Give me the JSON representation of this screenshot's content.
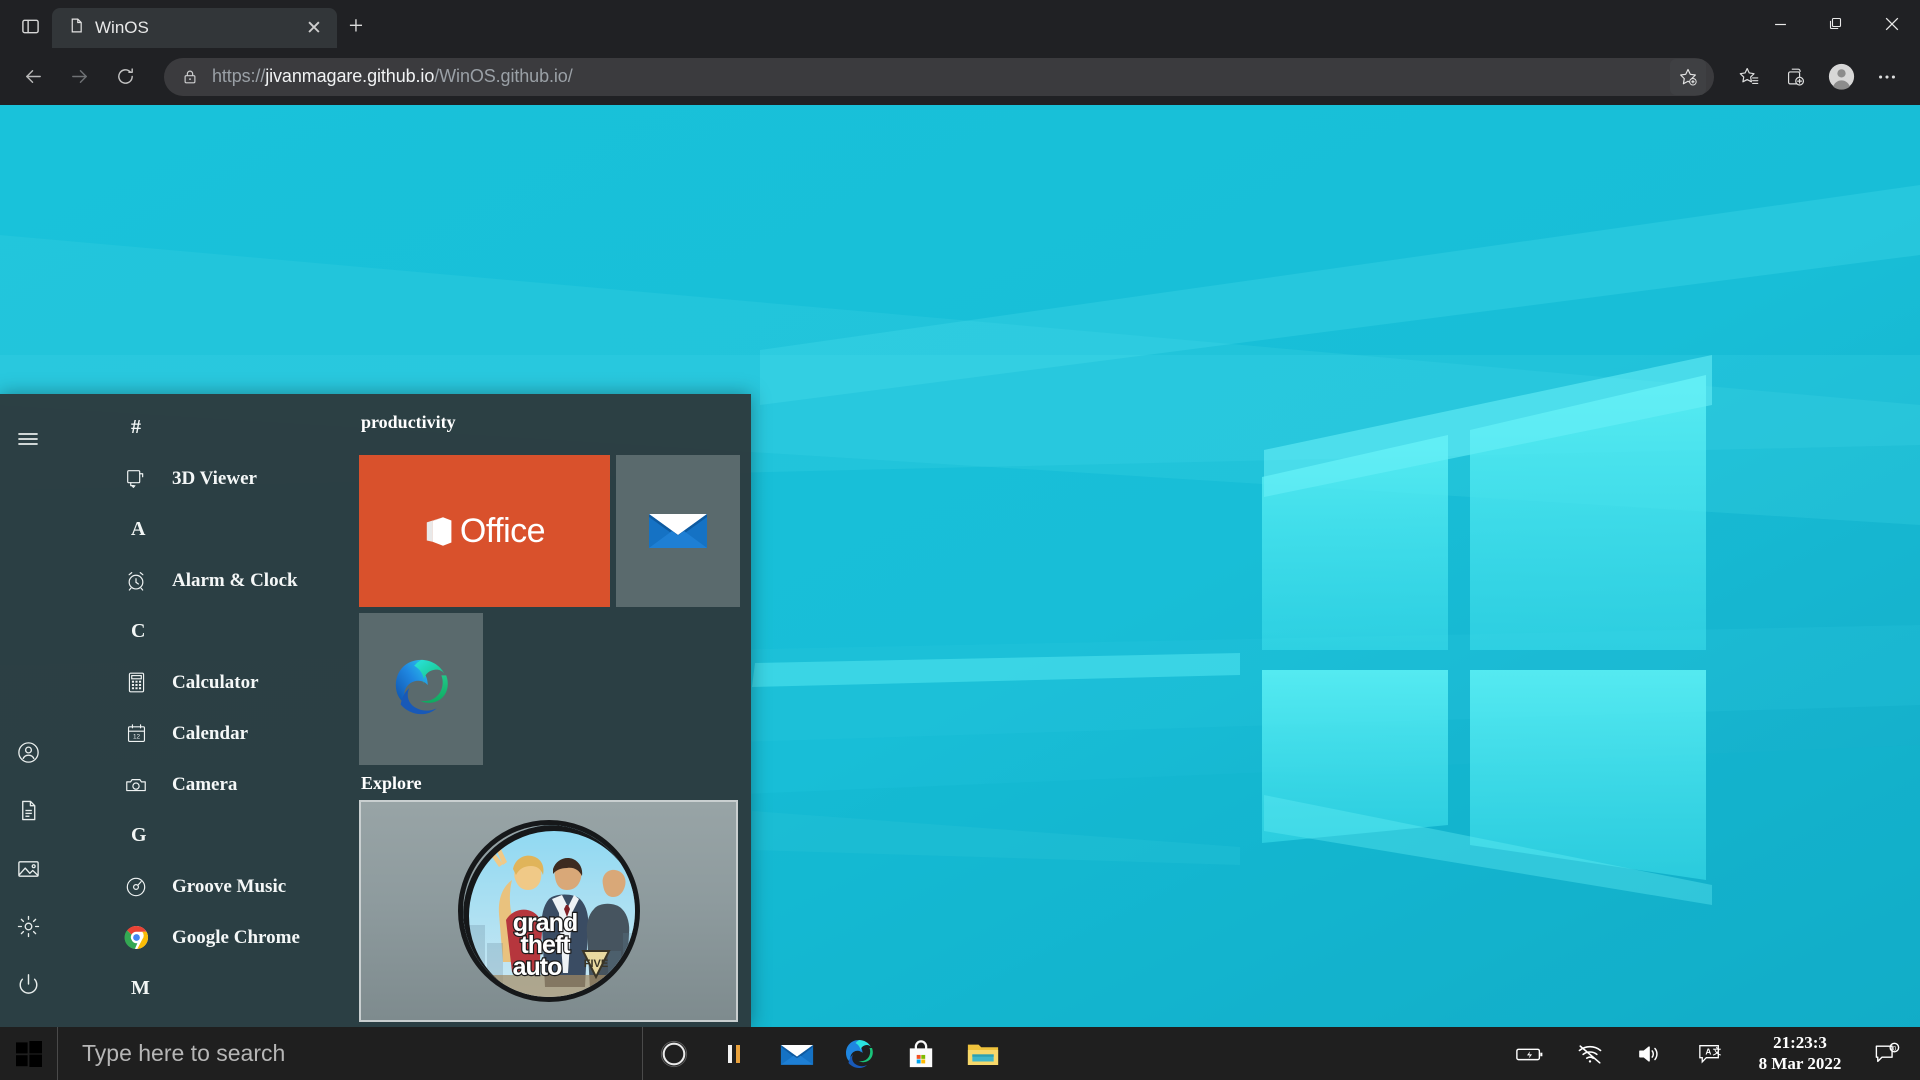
{
  "browser": {
    "tab": {
      "title": "WinOS",
      "icon": "page-icon",
      "close_label": "✕"
    },
    "new_tab_label": "+",
    "window_controls": {
      "minimize": "—",
      "maximize": "❐",
      "close": "✕"
    },
    "address": {
      "scheme": "https://",
      "host": "jivanmagare.github.io",
      "path": "/WinOS.github.io/",
      "full": "https://jivanmagare.github.io/WinOS.github.io/",
      "lock_icon": "lock-icon"
    },
    "nav": {
      "back": "back-icon",
      "forward": "forward-icon",
      "reload": "reload-icon"
    },
    "toolbar_icons": [
      "add-favorite-icon",
      "favorites-icon",
      "collections-icon",
      "profile-avatar",
      "settings-more-icon"
    ]
  },
  "start_menu": {
    "rail": [
      {
        "name": "hamburger-menu",
        "icon": "☰"
      },
      {
        "name": "user-account",
        "icon": "user-icon"
      },
      {
        "name": "documents",
        "icon": "document-icon"
      },
      {
        "name": "pictures",
        "icon": "picture-icon"
      },
      {
        "name": "settings",
        "icon": "gear-icon"
      },
      {
        "name": "power",
        "icon": "power-icon"
      }
    ],
    "app_list": [
      {
        "type": "letter",
        "label": "#"
      },
      {
        "type": "app",
        "label": "3D Viewer",
        "icon": "3d-viewer-icon"
      },
      {
        "type": "letter",
        "label": "A"
      },
      {
        "type": "app",
        "label": "Alarm & Clock",
        "icon": "alarm-clock-icon"
      },
      {
        "type": "letter",
        "label": "C"
      },
      {
        "type": "app",
        "label": "Calculator",
        "icon": "calculator-icon"
      },
      {
        "type": "app",
        "label": "Calendar",
        "icon": "calendar-icon"
      },
      {
        "type": "app",
        "label": "Camera",
        "icon": "camera-icon"
      },
      {
        "type": "letter",
        "label": "G"
      },
      {
        "type": "app",
        "label": "Groove Music",
        "icon": "groove-music-icon"
      },
      {
        "type": "app",
        "label": "Google Chrome",
        "icon": "chrome-icon"
      },
      {
        "type": "letter",
        "label": "M"
      }
    ],
    "tile_groups": [
      {
        "title": "productivity",
        "tiles": [
          {
            "name": "office",
            "label": "Office",
            "color": "#d9512c"
          },
          {
            "name": "mail",
            "label": "Mail",
            "color": "#5a6a6d"
          },
          {
            "name": "edge",
            "label": "Microsoft Edge",
            "color": "#5a6a6d"
          }
        ]
      },
      {
        "title": "Explore",
        "tiles": [
          {
            "name": "gta-v",
            "label": "Grand Theft Auto V",
            "caption_line1": "grand",
            "caption_line2": "theft",
            "caption_line3": "auto"
          }
        ]
      }
    ]
  },
  "taskbar": {
    "start_button": "windows-logo",
    "search_placeholder": "Type here to search",
    "items": [
      {
        "name": "cortana",
        "label": "Cortana"
      },
      {
        "name": "task-view",
        "label": "Task View"
      },
      {
        "name": "mail",
        "label": "Mail"
      },
      {
        "name": "edge",
        "label": "Microsoft Edge"
      },
      {
        "name": "microsoft-store",
        "label": "Microsoft Store"
      },
      {
        "name": "file-explorer",
        "label": "File Explorer"
      }
    ],
    "tray": [
      {
        "name": "battery",
        "label": "Battery"
      },
      {
        "name": "wifi-off",
        "label": "Network"
      },
      {
        "name": "volume",
        "label": "Volume"
      },
      {
        "name": "language",
        "label": "ENG Input"
      }
    ],
    "clock": {
      "time": "21:23:3",
      "date": "8 Mar 2022"
    },
    "action_center": "notifications-icon"
  },
  "colors": {
    "accent": "#17bdd8",
    "taskbar": "#1f1f1f",
    "start_bg": "#2c3b3f",
    "office_orange": "#d9512c",
    "tile_gray": "#5a6a6d",
    "clock_text": "#ffffff"
  }
}
